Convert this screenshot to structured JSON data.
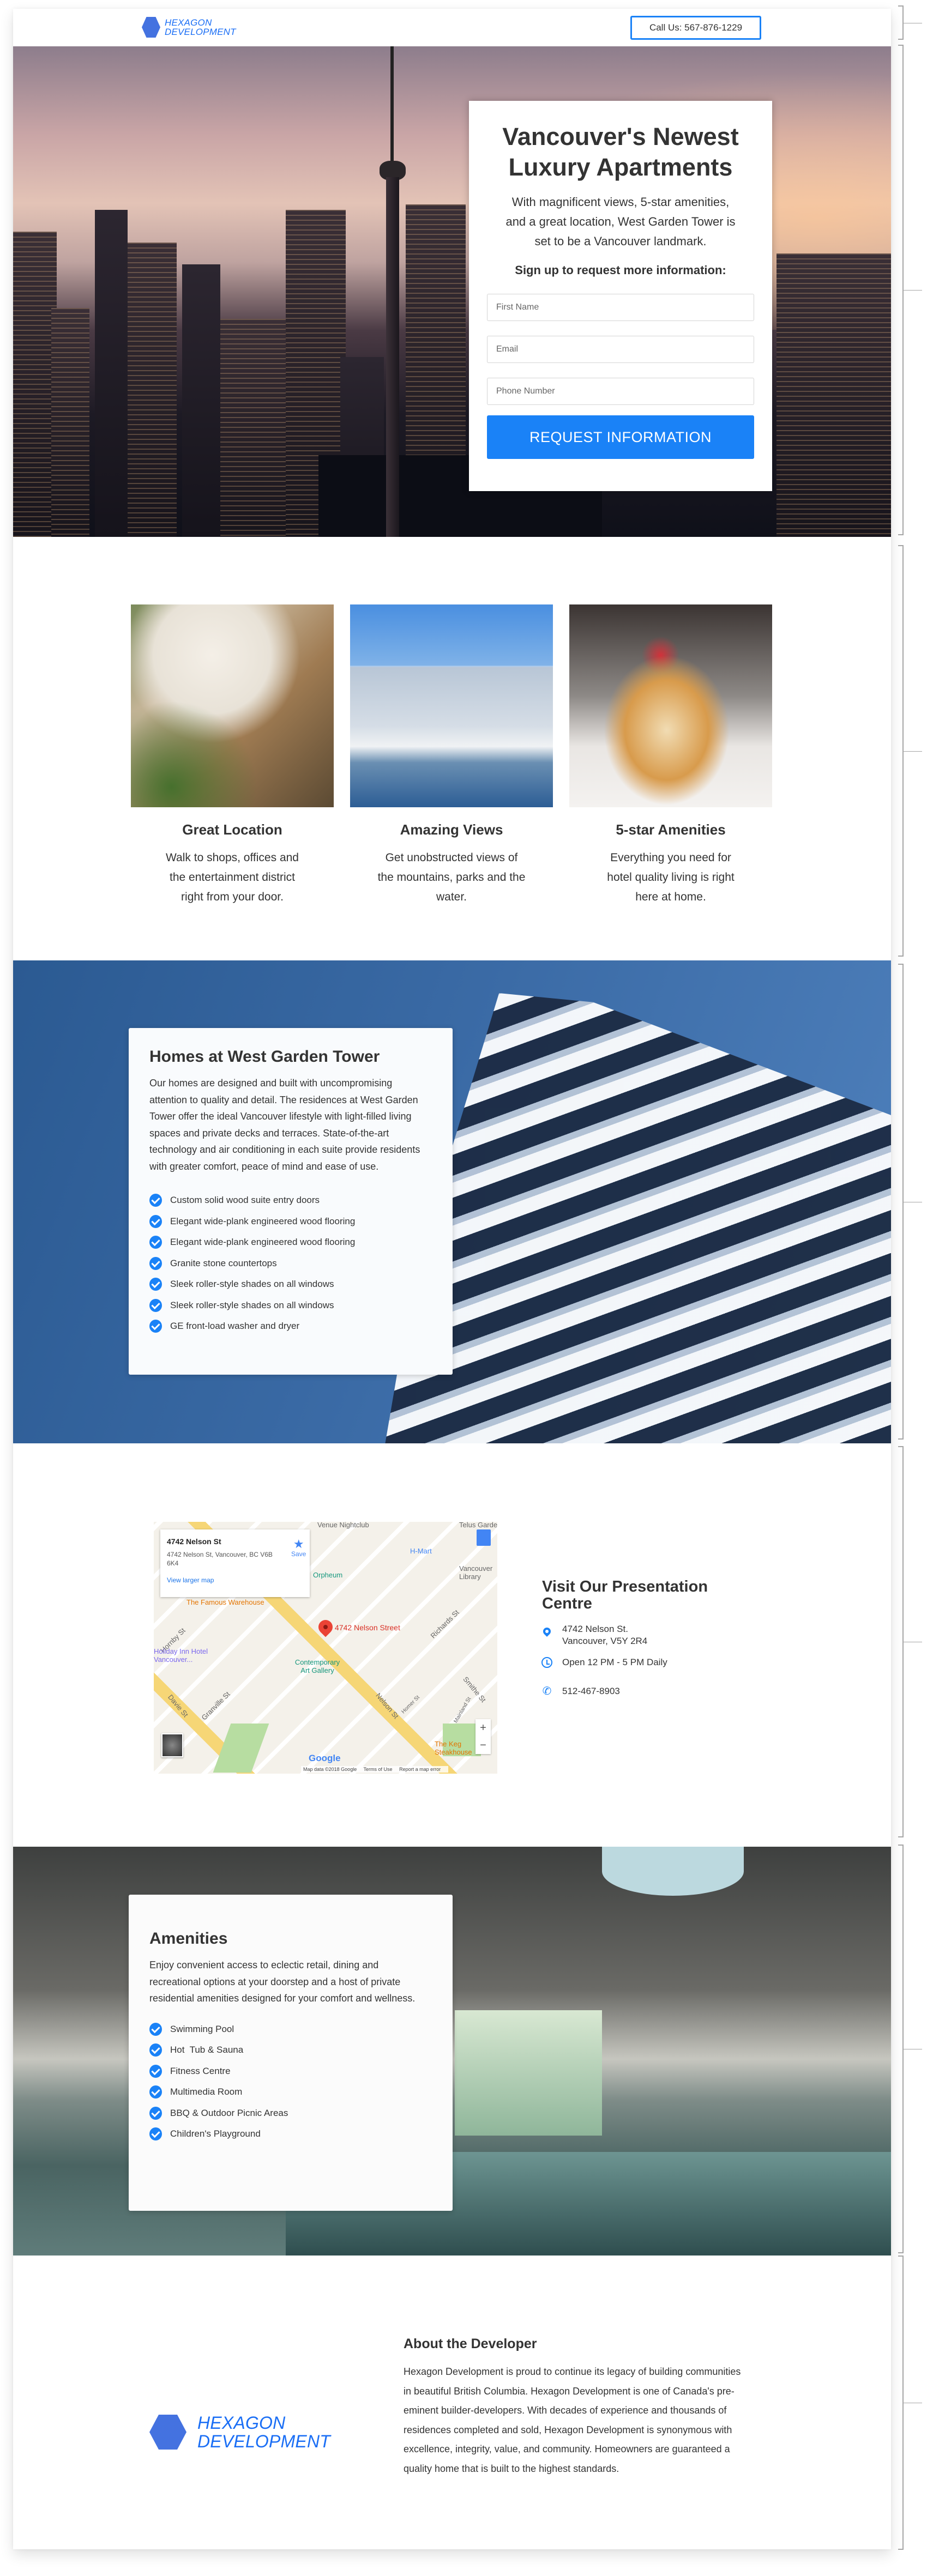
{
  "header": {
    "logo_line1": "HEXAGON",
    "logo_line2": "DEVELOPMENT",
    "call_button": "Call Us: 567-876-1229"
  },
  "hero": {
    "title": "Vancouver's Newest Luxury Apartments",
    "subtitle": "With magnificent views, 5-star amenities, and a great location, West Garden Tower is set to be a Vancouver landmark.",
    "cta_text": "Sign up to request more information:",
    "form": {
      "first_name_placeholder": "First Name",
      "email_placeholder": "Email",
      "phone_placeholder": "Phone Number",
      "submit_label": "REQUEST INFORMATION"
    }
  },
  "features": [
    {
      "title": "Great Location",
      "text": "Walk to shops, offices and the entertainment district right from your door.",
      "image": "people-working-laptop-photo"
    },
    {
      "title": "Amazing Views",
      "text": "Get unobstructed views of the mountains, parks and the water.",
      "image": "vancouver-marina-skyline-photo"
    },
    {
      "title": "5-star Amenities",
      "text": "Everything you need for hotel quality living is right here at home.",
      "image": "pancakes-dessert-photo"
    }
  ],
  "homes": {
    "title": "Homes at West Garden Tower",
    "body": "Our homes are designed and built with uncompromising attention to quality and detail. The residences at West Garden Tower offer the ideal Vancouver lifestyle with light-filled living spaces and private decks and terraces. State-of-the-art technology and air conditioning in each suite provide residents with greater comfort, peace of mind and ease of use.",
    "features": [
      "Custom solid wood suite entry doors",
      "Elegant wide-plank engineered wood flooring",
      "Elegant wide-plank engineered wood flooring",
      "Granite stone countertops",
      "Sleek roller-style shades on all windows",
      "Sleek roller-style shades on all windows",
      "GE front-load washer and dryer"
    ]
  },
  "map": {
    "place_title": "4742 Nelson St",
    "place_address": "4742 Nelson St, Vancouver, BC V6B 6K4",
    "view_larger": "View larger map",
    "save_label": "Save",
    "pin_label": "4742 Nelson Street",
    "labels": [
      "Venue Nightclub",
      "Telus Garden",
      "H-Mart",
      "Orpheum",
      "Vancouver Library",
      "The Famous Warehouse",
      "Hornby St",
      "Holiday Inn Hotel Vancouver...",
      "Contemporary Art Gallery",
      "Richards St",
      "Smithe St",
      "Davie St",
      "Granville St",
      "Nelson St",
      "Homer St",
      "Mainland St",
      "The Keg Steakhouse"
    ],
    "google": "Google",
    "footer": [
      "Map data ©2018 Google",
      "Terms of Use",
      "Report a map error"
    ],
    "zoom_in": "+",
    "zoom_out": "−"
  },
  "visit": {
    "title": "Visit Our Presentation Centre",
    "address_line1": "4742 Nelson St.",
    "address_line2": "Vancouver, V5Y 2R4",
    "hours": "Open 12 PM  - 5 PM Daily",
    "phone": "512-467-8903"
  },
  "amenities": {
    "title": "Amenities",
    "body": "Enjoy convenient access to eclectic retail, dining and recreational options at your doorstep and a host of private residential amenities designed for your comfort and wellness.",
    "items": [
      "Swimming Pool",
      "Hot  Tub & Sauna",
      "Fitness Centre",
      "Multimedia Room",
      "BBQ & Outdoor Picnic Areas",
      "Children's Playground"
    ]
  },
  "about": {
    "logo_line1": "HEXAGON",
    "logo_line2": "DEVELOPMENT",
    "title": "About the Developer",
    "body": "Hexagon Development is proud to continue its legacy of building communities in beautiful British Columbia. Hexagon Development is one of Canada's pre-eminent builder-developers. With decades of experience and thousands of residences completed and sold, Hexagon Development is synonymous with excellence, integrity, value, and community. Homeowners are guaranteed a quality home that is built to the highest standards."
  },
  "colors": {
    "accent": "#1a82f7",
    "logo_blue": "#1a6ef5",
    "hexagon": "#4472e0",
    "text": "#333333"
  }
}
